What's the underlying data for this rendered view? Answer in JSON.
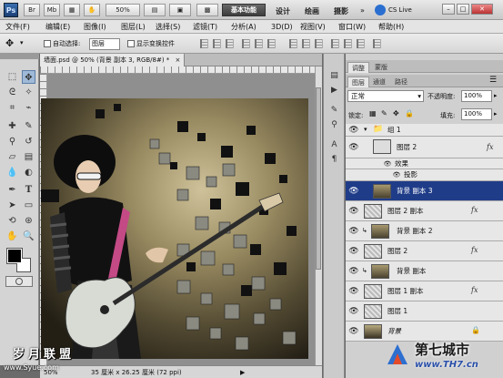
{
  "titlebar": {
    "app_logo": "Ps",
    "mini_bridge": "Br",
    "mini_mb": "Mb",
    "zoom": "50%",
    "workspace_active": "基本功能",
    "workspace_links": [
      "设计",
      "绘画",
      "摄影"
    ],
    "cs_live": "CS Live"
  },
  "menu": {
    "items": [
      "文件(F)",
      "编辑(E)",
      "图像(I)",
      "图层(L)",
      "选择(S)",
      "滤镜(T)",
      "分析(A)",
      "3D(D)",
      "视图(V)",
      "窗口(W)",
      "帮助(H)"
    ]
  },
  "options": {
    "auto_select_label": "自动选择:",
    "auto_select_value": "图层",
    "show_transform_label": "显示变换控件"
  },
  "document": {
    "tab_title": "墙面.psd @ 50% (背景 副本 3, RGB/8#) *",
    "close_glyph": "×"
  },
  "status": {
    "zoom": "50%",
    "doc_size": "35 厘米 x 26.25 厘米 (72 ppi)"
  },
  "adjust_panel": {
    "tabs": [
      "调整",
      "蒙版"
    ]
  },
  "layers_panel": {
    "tabs": [
      "图层",
      "通道",
      "路径"
    ],
    "blend_mode": "正常",
    "opacity_label": "不透明度:",
    "opacity_value": "100%",
    "lock_label": "锁定:",
    "fill_label": "填充:",
    "fill_value": "100%"
  },
  "layers": [
    {
      "name": "组 1",
      "type": "group"
    },
    {
      "name": "图层 2",
      "type": "layer",
      "fx": "fx"
    },
    {
      "name": "效果",
      "type": "effect"
    },
    {
      "name": "投影",
      "type": "effect"
    },
    {
      "name": "背景 副本 3",
      "type": "layer",
      "selected": true
    },
    {
      "name": "图层 2 副本",
      "type": "layer",
      "fx": "fx"
    },
    {
      "name": "背景 副本 2",
      "type": "layer"
    },
    {
      "name": "图层 2",
      "type": "layer",
      "fx": "fx"
    },
    {
      "name": "背景 副本",
      "type": "layer"
    },
    {
      "name": "图层 1 副本",
      "type": "layer",
      "fx": "fx"
    },
    {
      "name": "图层 1",
      "type": "layer"
    },
    {
      "name": "背景",
      "type": "background"
    }
  ],
  "watermarks": {
    "left_top": "岁月联盟",
    "left_bottom": "www.Syue.com",
    "right_top": "第七城市",
    "right_bottom": "www.TH7.cn"
  },
  "colors": {
    "selection_blue": "#1f3c88",
    "panel_bg": "#d0d0d0"
  }
}
